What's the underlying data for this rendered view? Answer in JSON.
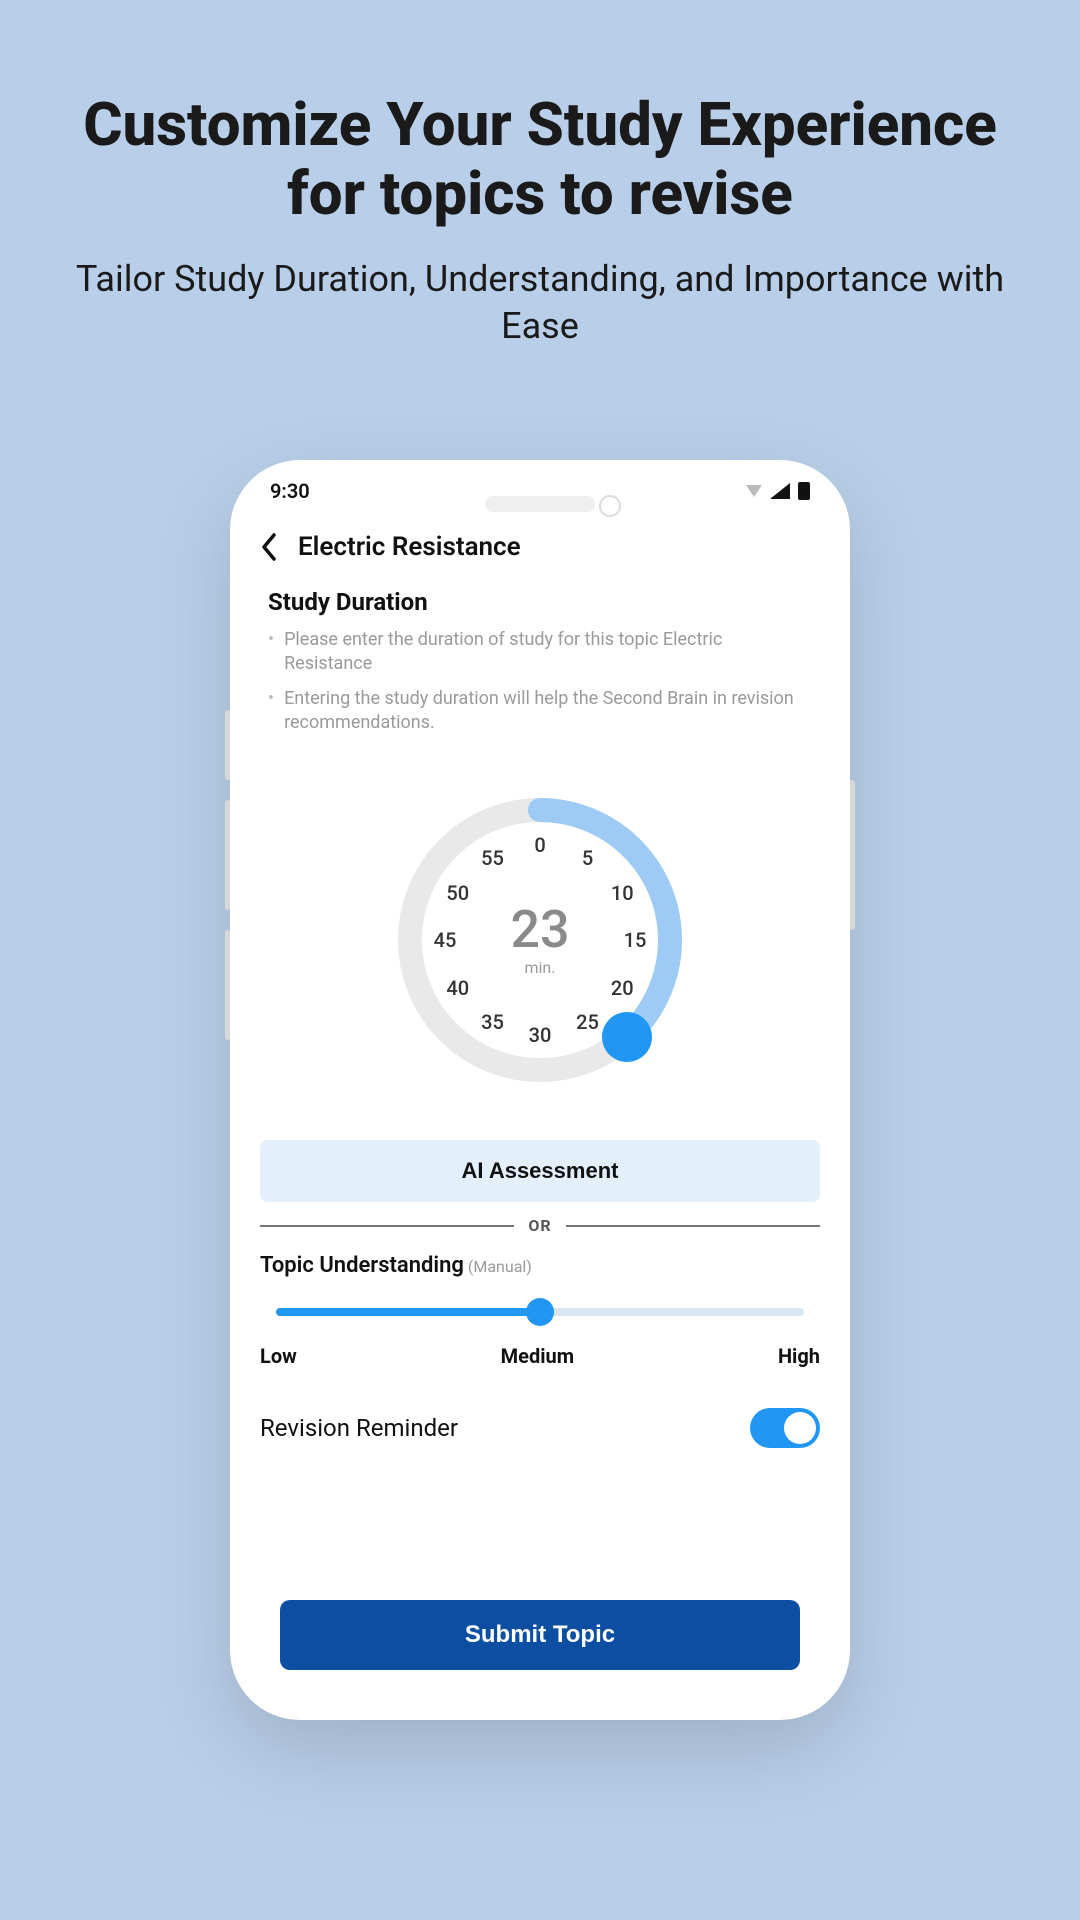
{
  "hero": {
    "title": "Customize Your Study Experience for topics to revise",
    "subtitle": "Tailor Study Duration, Understanding, and Importance with Ease"
  },
  "status": {
    "time": "9:30"
  },
  "header": {
    "title": "Electric Resistance"
  },
  "duration": {
    "section_label": "Study Duration",
    "bullet1": "Please enter the duration of study for this topic Electric Resistance",
    "bullet2": "Entering the study duration will help the Second Brain in revision recommendations.",
    "value": "23",
    "unit": "min.",
    "ticks": [
      "0",
      "5",
      "10",
      "15",
      "20",
      "25",
      "30",
      "35",
      "40",
      "45",
      "50",
      "55"
    ],
    "selected_minutes": 23,
    "max_minutes": 60
  },
  "ai": {
    "button_label": "AI Assessment",
    "or_label": "OR"
  },
  "understanding": {
    "label": "Topic Understanding",
    "manual_hint": "(Manual)",
    "low": "Low",
    "medium": "Medium",
    "high": "High",
    "value_percent": 50
  },
  "reminder": {
    "label": "Revision Reminder",
    "enabled": true
  },
  "submit": {
    "label": "Submit Topic"
  },
  "colors": {
    "accent": "#2196f3",
    "primary": "#0b4ea2",
    "bg": "#b9cfe9"
  }
}
